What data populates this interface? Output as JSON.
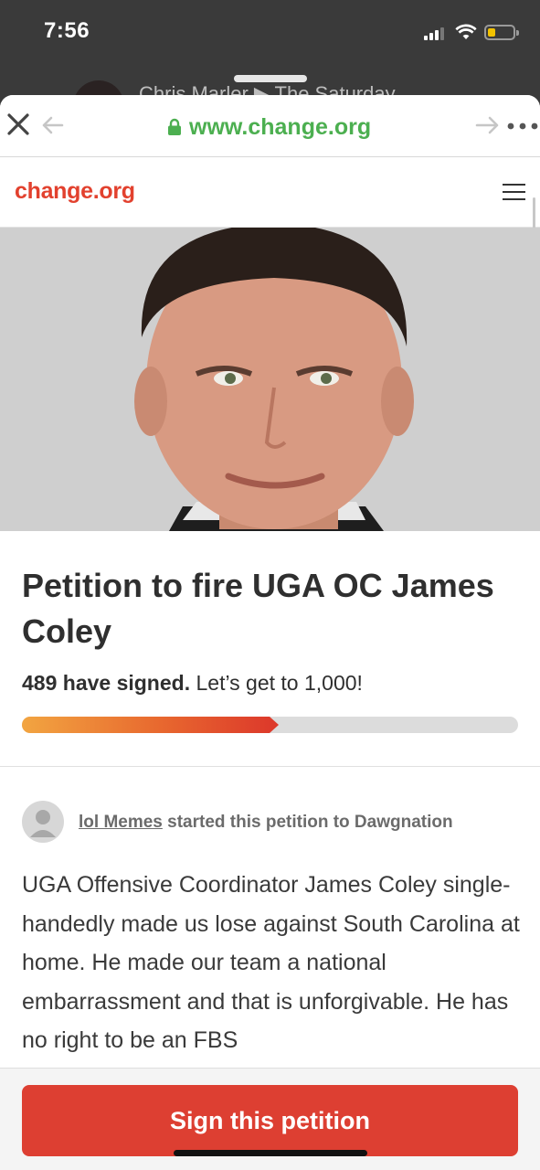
{
  "status_bar": {
    "time": "7:56",
    "battery_color": "#f2c200"
  },
  "background_app": {
    "peek_text": "Chris Marler ▶ The Saturday"
  },
  "browser": {
    "url": "www.change.org",
    "url_color": "#4caf50",
    "icons": [
      "close-icon",
      "back-arrow-icon",
      "lock-icon",
      "forward-arrow-icon",
      "more-icon"
    ]
  },
  "site": {
    "logo": "change.org",
    "brand_color": "#e2412e"
  },
  "petition": {
    "title": "Petition to fire UGA OC James Coley",
    "signed_count": "489 have signed.",
    "goal_text": "Let’s get to 1,000!",
    "progress_fraction": 0.489,
    "starter_name": "lol Memes",
    "starter_suffix": "started this petition to Dawgnation",
    "body": "UGA Offensive Coordinator James Coley single-handedly made us lose against South Carolina at home. He made our team a national embarrassment and that is unforgivable. He has no right to be an FBS",
    "sign_button": "Sign this petition",
    "button_color": "#dd3f32"
  }
}
